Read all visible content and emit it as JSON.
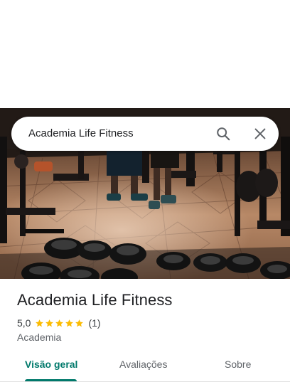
{
  "search": {
    "query": "Academia Life Fitness"
  },
  "place": {
    "name": "Academia Life Fitness",
    "rating": "5,0",
    "stars": 5,
    "review_count": "(1)",
    "category": "Academia"
  },
  "tabs": [
    {
      "label": "Visão geral",
      "active": true
    },
    {
      "label": "Avaliações",
      "active": false
    },
    {
      "label": "Sobre",
      "active": false
    }
  ],
  "icons": {
    "search": "search-icon",
    "close": "close-icon",
    "star": "star-icon"
  },
  "colors": {
    "accent": "#00796b",
    "star": "#fbbc04",
    "text": "#202124",
    "secondary_text": "#5f6368"
  }
}
